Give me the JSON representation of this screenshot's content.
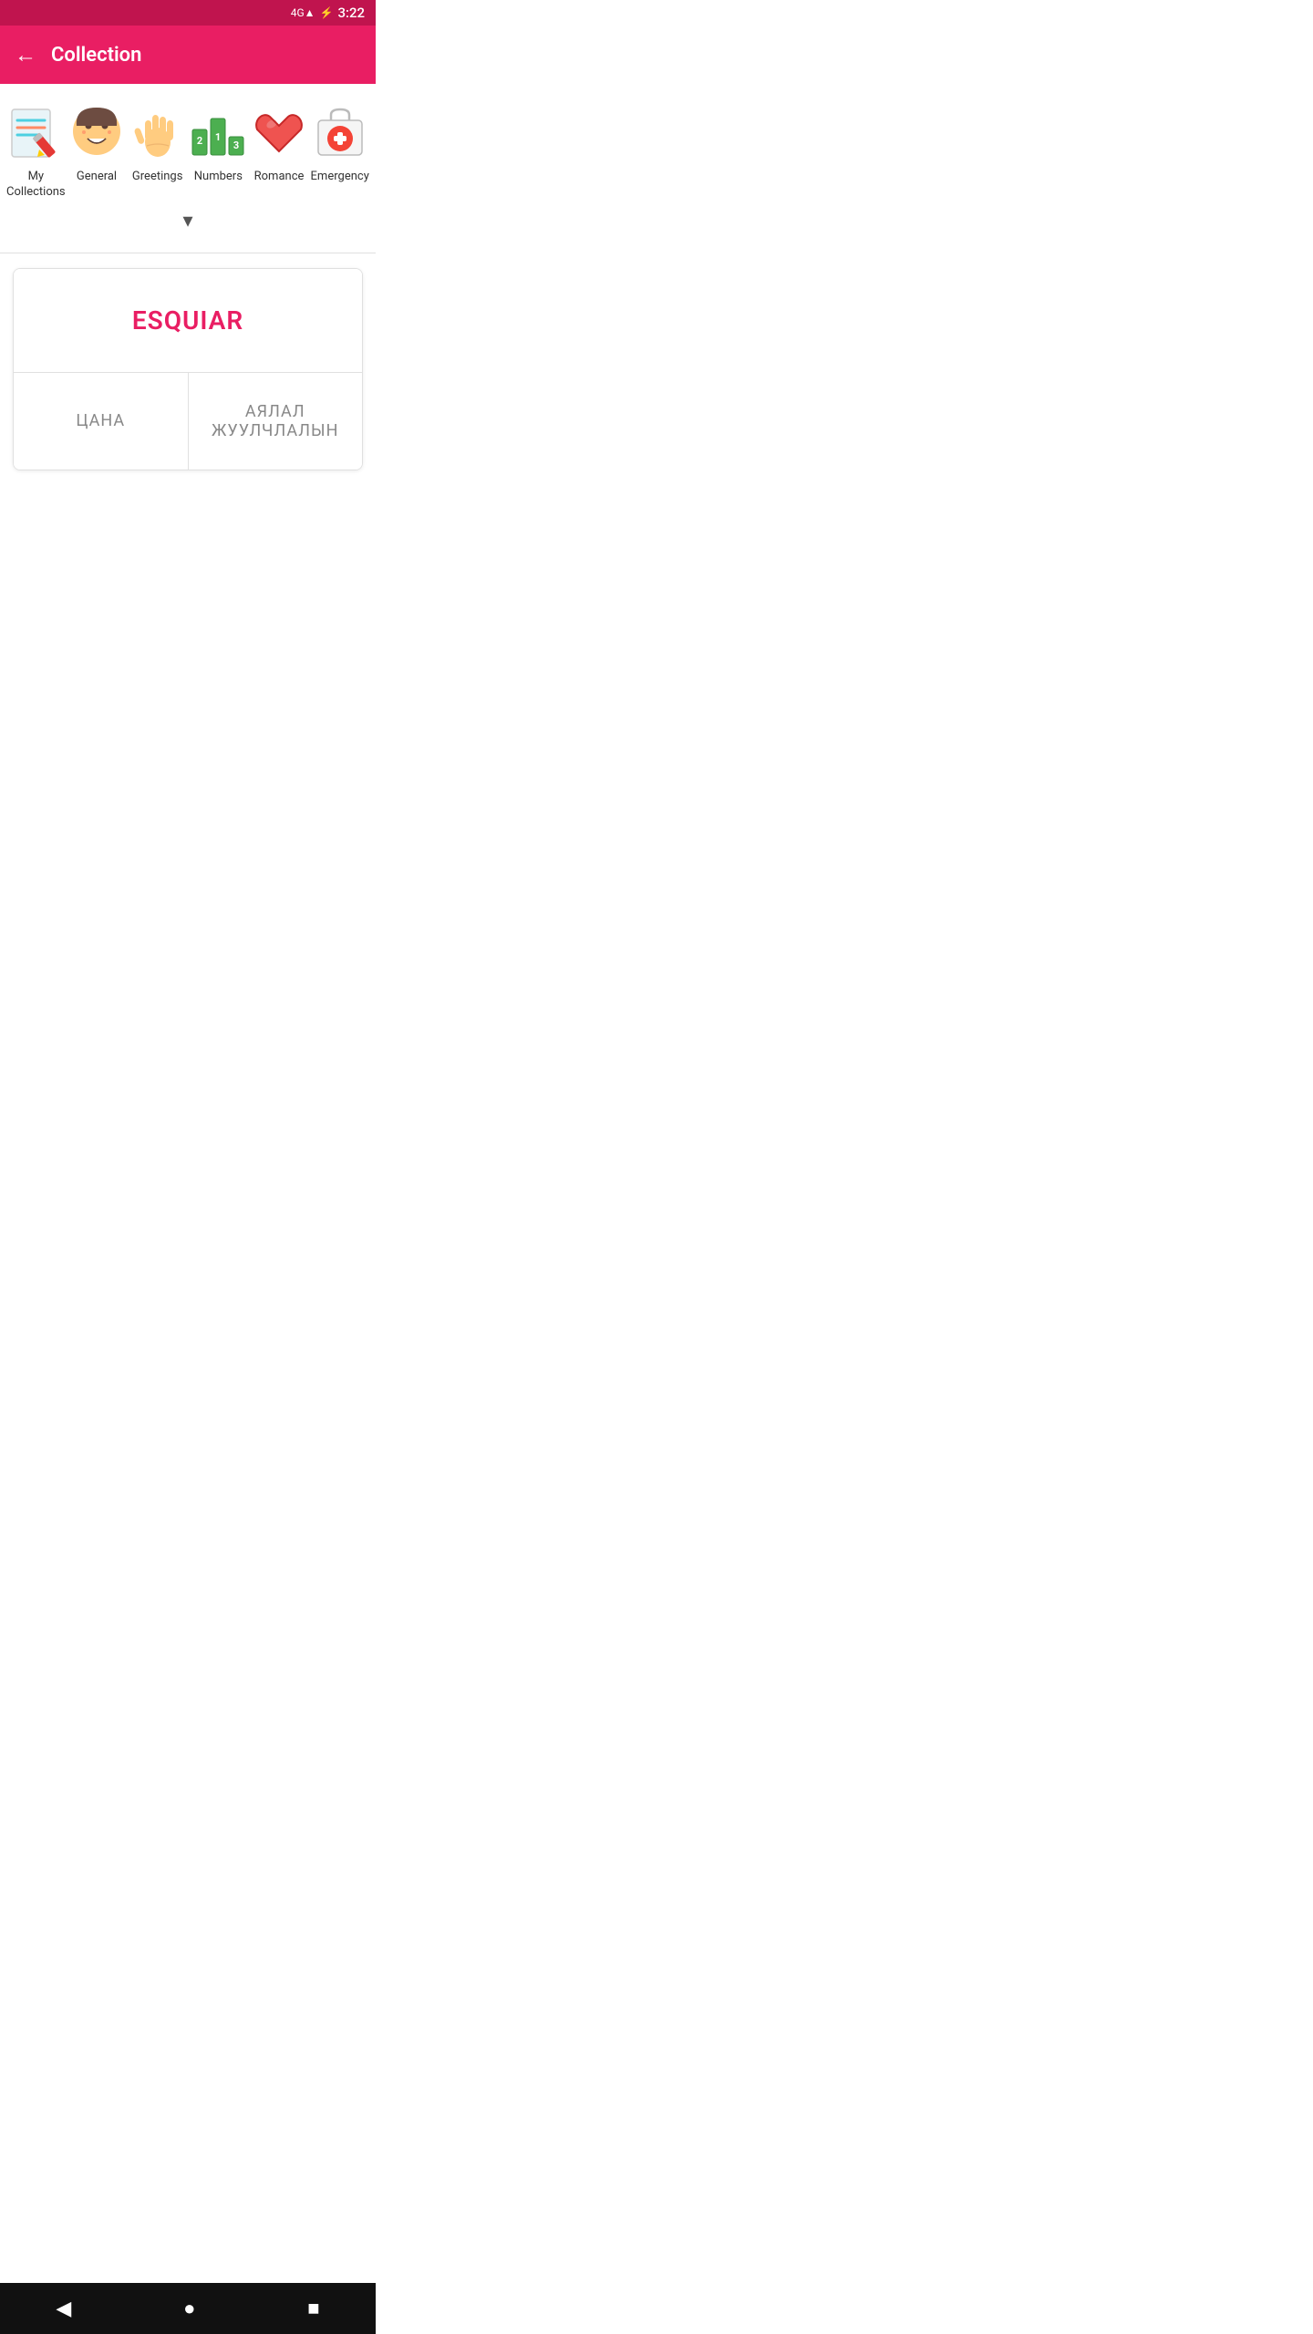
{
  "statusBar": {
    "time": "3:22",
    "signal": "4G",
    "battery": "charging"
  },
  "header": {
    "title": "Collection",
    "backLabel": "←"
  },
  "categories": [
    {
      "id": "my-collections",
      "label": "My Collections",
      "icon": "notebook"
    },
    {
      "id": "general",
      "label": "General",
      "icon": "face"
    },
    {
      "id": "greetings",
      "label": "Greetings",
      "icon": "hand"
    },
    {
      "id": "numbers",
      "label": "Numbers",
      "icon": "numbers"
    },
    {
      "id": "romance",
      "label": "Romance",
      "icon": "heart"
    },
    {
      "id": "emergency",
      "label": "Emergency",
      "icon": "firstaid"
    }
  ],
  "card": {
    "mainWord": "ESQUIAR",
    "translationLeft": "ЦАНА",
    "translationRight": "АЯЛАЛ ЖУУЛЧЛАЛЫН"
  },
  "chevron": "▾",
  "nav": {
    "back": "◀",
    "home": "●",
    "square": "■"
  }
}
